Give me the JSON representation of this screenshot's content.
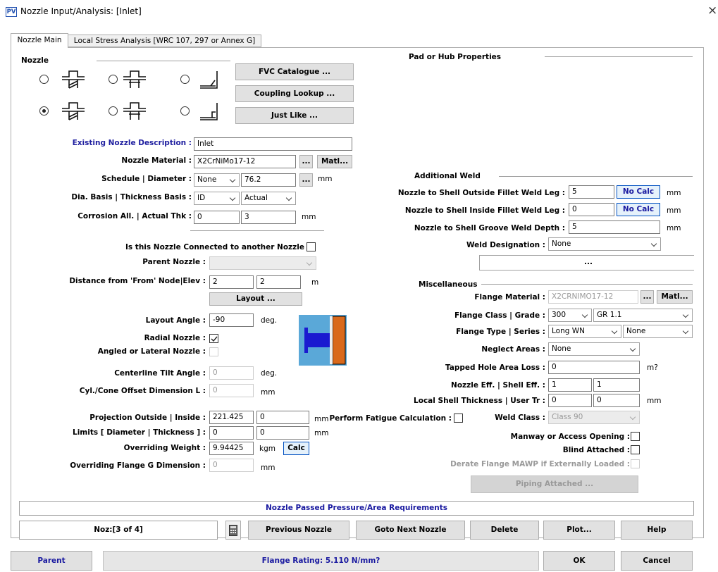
{
  "window": {
    "title": "Nozzle Input/Analysis:  [Inlet]",
    "app_badge": "PV",
    "close_glyph": "×"
  },
  "tabs": [
    {
      "label": "Nozzle Main"
    },
    {
      "label": "Local Stress Analysis [WRC 107, 297 or Annex G]"
    }
  ],
  "nozzle_section": {
    "title": "Nozzle",
    "buttons": {
      "fvc": "FVC Catalogue ...",
      "coupling": "Coupling Lookup ...",
      "just_like": "Just Like ..."
    }
  },
  "pad_section": {
    "title": "Pad or Hub Properties"
  },
  "fields": {
    "desc_label": "Existing Nozzle Description :",
    "desc_value": "Inlet",
    "material_label": "Nozzle Material :",
    "material_value": "X2CrNiMo17-12",
    "ellipsis": "...",
    "matl": "Matl...",
    "schedule_label": "Schedule | Diameter :",
    "schedule_value": "None",
    "diameter_value": "76.2",
    "mm": "mm",
    "dia_basis_label": "Dia. Basis | Thickness Basis :",
    "dia_basis_value": "ID",
    "thk_basis_value": "Actual",
    "corrosion_label": "Corrosion All. | Actual Thk :",
    "corrosion_value": "0",
    "actual_thk_value": "3",
    "connected_label": "Is this Nozzle Connected to another Nozzle",
    "parent_nozzle_label": "Parent Nozzle :",
    "distance_label": "Distance from 'From' Node|Elev :",
    "distance_value": "2",
    "elev_value": "2",
    "m": "m",
    "layout_button": "Layout ...",
    "layout_angle_label": "Layout Angle :",
    "layout_angle_value": "-90",
    "deg": "deg.",
    "radial_label": "Radial Nozzle :",
    "angled_label": "Angled or Lateral Nozzle :",
    "tilt_label": "Centerline Tilt Angle :",
    "tilt_value": "0",
    "offset_label": "Cyl./Cone Offset Dimension L :",
    "offset_value": "0",
    "projection_label": "Projection Outside | Inside :",
    "projection_out": "221.425",
    "projection_in": "0",
    "limits_label": "Limits [ Diameter | Thickness ] :",
    "limits_dia": "0",
    "limits_thk": "0",
    "weight_label": "Overriding Weight :",
    "weight_value": "9.94425",
    "kgm": "kgm",
    "calc": "Calc",
    "flange_g_label": "Overriding Flange G Dimension :",
    "flange_g_value": "0",
    "fatigue_label": "Perform Fatigue Calculation :"
  },
  "additional_weld": {
    "title": "Additional Weld",
    "outside_label": "Nozzle to Shell Outside Fillet Weld Leg :",
    "outside_value": "5",
    "inside_label": "Nozzle to Shell Inside Fillet Weld Leg :",
    "inside_value": "0",
    "groove_label": "Nozzle to Shell Groove Weld Depth :",
    "groove_value": "5",
    "no_calc": "No Calc",
    "designation_label": "Weld Designation :",
    "designation_value": "None",
    "dots": "..."
  },
  "misc": {
    "title": "Miscellaneous",
    "flange_material_label": "Flange Material :",
    "flange_material_value": "X2CRNIMO17-12",
    "class_label": "Flange Class | Grade :",
    "class_value": "300",
    "grade_value": "GR 1.1",
    "type_label": "Flange Type | Series :",
    "type_value": "Long WN",
    "series_value": "None",
    "neglect_label": "Neglect Areas :",
    "neglect_value": "None",
    "tapped_label": "Tapped Hole Area Loss :",
    "tapped_value": "0",
    "m2": "m?",
    "eff_label": "Nozzle Eff. | Shell Eff. :",
    "nozzle_eff": "1",
    "shell_eff": "1",
    "local_thk_label": "Local Shell Thickness | User Tr :",
    "local_thk_value": "0",
    "user_tr_value": "0",
    "weld_class_label": "Weld Class :",
    "weld_class_value": "Class 90",
    "manway_label": "Manway or Access Opening :",
    "blind_label": "Blind Attached :",
    "derate_label": "Derate Flange MAWP if Externally Loaded :",
    "piping_button": "Piping Attached ..."
  },
  "status": {
    "message": "Nozzle Passed Pressure/Area Requirements"
  },
  "bottom": {
    "noz_counter": "Noz:[3 of  4]",
    "previous": "Previous Nozzle",
    "next": "Goto Next Nozzle",
    "delete": "Delete",
    "plot": "Plot...",
    "help": "Help",
    "parent": "Parent",
    "flange_rating": "Flange Rating: 5.110  N/mm?",
    "ok": "OK",
    "cancel": "Cancel"
  },
  "colors": {
    "title_bar": "#ffffff",
    "label_blue": "#2020a0",
    "nozzle_blue": "#1a1ad0",
    "shell_orange": "#d9691c",
    "flange_rating_blue": "#1a1aa0"
  }
}
